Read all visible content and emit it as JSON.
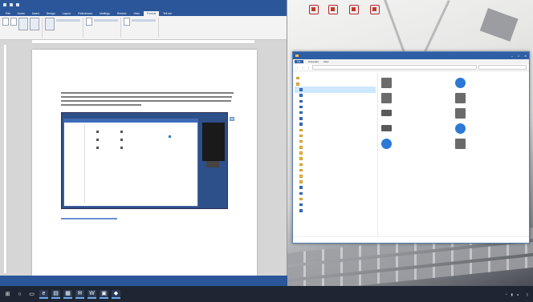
{
  "word": {
    "title": "",
    "tabs": [
      "File",
      "Home",
      "Insert",
      "Design",
      "Layout",
      "References",
      "Mailings",
      "Review",
      "View",
      "Format",
      "Tell me"
    ],
    "active_tab": "Format",
    "status_left": "",
    "status_right": "",
    "zoom": ""
  },
  "desktop": {
    "icons": [
      "",
      "",
      "",
      ""
    ]
  },
  "explorer": {
    "title": "",
    "ribbon_tabs": [
      "File",
      "Computer",
      "View"
    ],
    "path": "",
    "search_placeholder": "",
    "nav_items": [
      {
        "label": "",
        "type": "folder"
      },
      {
        "label": "",
        "type": "folder"
      },
      {
        "label": "",
        "type": "blue"
      },
      {
        "label": "",
        "type": "blue"
      },
      {
        "label": "",
        "type": "blue"
      },
      {
        "label": "",
        "type": "blue"
      },
      {
        "label": "",
        "type": "blue"
      },
      {
        "label": "",
        "type": "blue"
      },
      {
        "label": "",
        "type": "blue"
      },
      {
        "label": "",
        "type": "folder"
      },
      {
        "label": "",
        "type": "folder"
      },
      {
        "label": "",
        "type": "folder"
      },
      {
        "label": "",
        "type": "folder"
      },
      {
        "label": "",
        "type": "folder"
      },
      {
        "label": "",
        "type": "folder"
      },
      {
        "label": "",
        "type": "folder"
      },
      {
        "label": "",
        "type": "folder"
      },
      {
        "label": "",
        "type": "folder"
      },
      {
        "label": "",
        "type": "folder"
      },
      {
        "label": "",
        "type": "blue"
      },
      {
        "label": "",
        "type": "blue"
      },
      {
        "label": "",
        "type": "folder"
      },
      {
        "label": "",
        "type": "blue"
      },
      {
        "label": "",
        "type": "blue"
      }
    ],
    "tiles": [
      {
        "label": "",
        "icon": "grey"
      },
      {
        "label": "",
        "icon": "blue"
      },
      {
        "label": "",
        "icon": "grey"
      },
      {
        "label": "",
        "icon": "grey"
      },
      {
        "label": "",
        "icon": "drive"
      },
      {
        "label": "",
        "icon": "grey"
      },
      {
        "label": "",
        "icon": "drive"
      },
      {
        "label": "",
        "icon": "blue"
      },
      {
        "label": "",
        "icon": "blue"
      },
      {
        "label": "",
        "icon": "grey"
      }
    ],
    "status": ""
  },
  "taskbar": {
    "start_icon": "windows-logo-icon",
    "apps": [
      "search-icon",
      "task-view-icon",
      "edge-icon",
      "file-explorer-icon",
      "store-icon",
      "mail-icon",
      "word-icon",
      "photos-icon",
      "app-icon"
    ],
    "time": "",
    "date": ""
  },
  "colors": {
    "word_blue": "#2b579a",
    "explorer_blue": "#2e5fa5",
    "taskbar": "#1e2633"
  }
}
